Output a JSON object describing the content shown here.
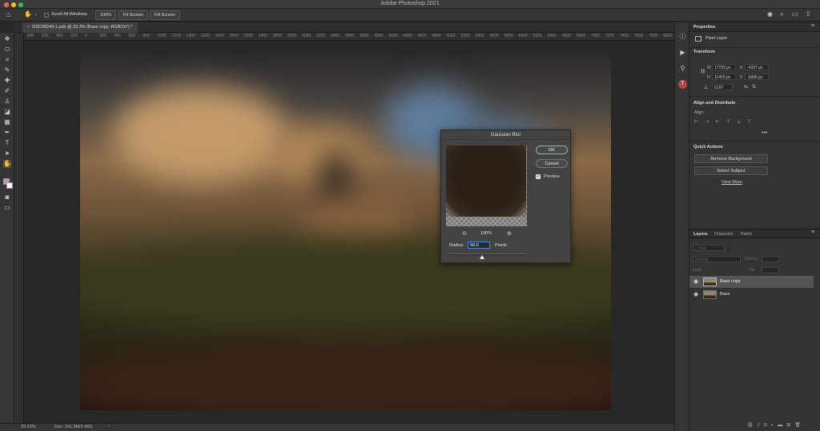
{
  "app": {
    "title": "Adobe Photoshop 2021"
  },
  "options_bar": {
    "scroll_all_label": "Scroll All Windows",
    "zoom_label": "100%",
    "fit_screen_label": "Fit Screen",
    "fill_screen_label": "Fill Screen"
  },
  "document": {
    "tab_label": "DSC08249-1.psb @ 33.3% (Base copy, RGB/16*) *"
  },
  "ruler": {
    "labels": [
      "800",
      "600",
      "400",
      "200",
      "0",
      "200",
      "400",
      "600",
      "800",
      "1000",
      "1200",
      "1400",
      "1600",
      "1800",
      "2000",
      "2200",
      "2400",
      "2600",
      "2800",
      "3000",
      "3200",
      "3400",
      "3600",
      "3800",
      "4000",
      "4200",
      "4400",
      "4600",
      "4800",
      "5000",
      "5200",
      "5400",
      "5600",
      "5800",
      "6000",
      "6200",
      "6400",
      "6600",
      "6800",
      "7000",
      "7200",
      "7400",
      "7600",
      "7800",
      "8000"
    ]
  },
  "status": {
    "zoom": "33.33%",
    "doc": "Doc: 241.3M/2.46G"
  },
  "dialog": {
    "title": "Gaussian Blur",
    "ok_label": "OK",
    "cancel_label": "Cancel",
    "preview_label": "Preview",
    "preview_checked": true,
    "zoom_out_icon": "zoom-out-icon",
    "zoom_level": "100%",
    "zoom_in_icon": "zoom-in-icon",
    "radius_label": "Radius:",
    "radius_value": "50.0",
    "radius_unit": "Pixels",
    "radius_slider_fraction": 0.43
  },
  "properties": {
    "tab_label": "Properties",
    "layer_type": "Pixel Layer",
    "transform": {
      "heading": "Transform",
      "w_label": "W",
      "w_value": "17703 px",
      "x_label": "X",
      "x_value": "-4337 px",
      "h_label": "H",
      "h_value": "11403 px",
      "y_label": "Y",
      "y_value": "-3606 px",
      "angle_value": "0.00°"
    },
    "align": {
      "heading": "Align and Distribute",
      "align_label": "Align:"
    },
    "quick_actions": {
      "heading": "Quick Actions",
      "remove_bg_label": "Remove Background",
      "select_subject_label": "Select Subject",
      "view_more_label": "View More"
    }
  },
  "layers_panel": {
    "tabs": [
      "Layers",
      "Channels",
      "Paths"
    ],
    "kind_label": "Kind",
    "blend_mode": "Normal",
    "opacity_label": "Opacity:",
    "fill_label": "Fill:",
    "lock_label": "Lock:",
    "layers": [
      {
        "name": "Base copy",
        "selected": true
      },
      {
        "name": "Base",
        "selected": false
      }
    ]
  },
  "colors": {
    "accent": "#3d7fd6",
    "foreground_swatch": "#c98fc0",
    "background_swatch": "#ffffff"
  }
}
